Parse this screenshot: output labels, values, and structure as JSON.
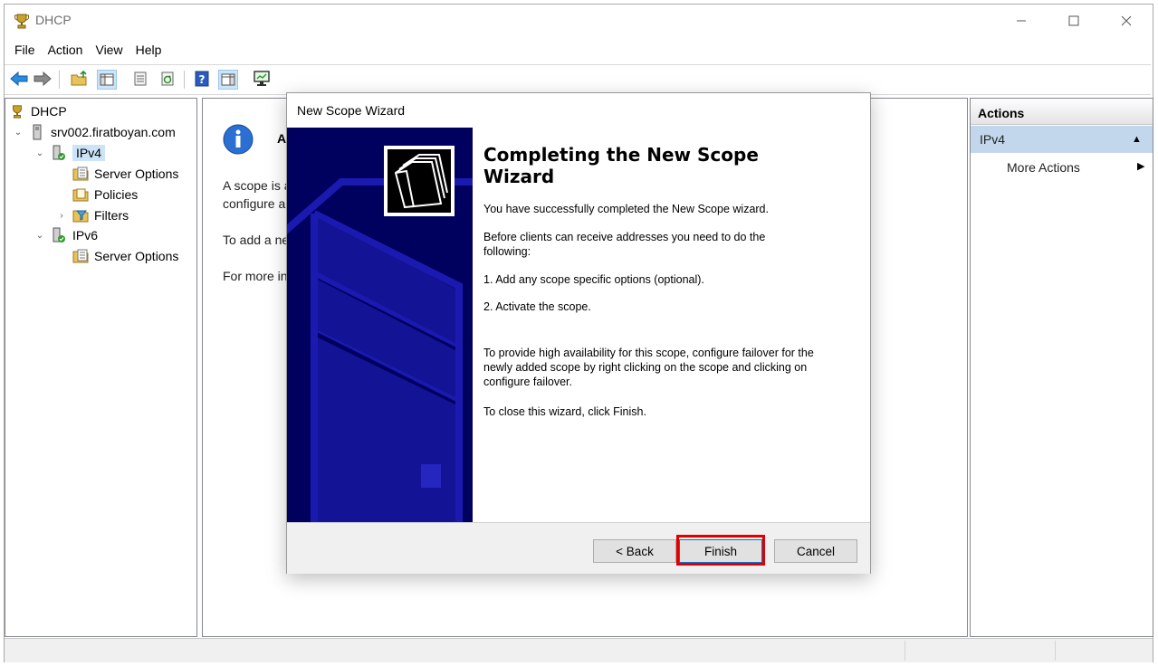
{
  "window": {
    "title": "DHCP",
    "icons": {
      "app": "dhcp-trophy-icon",
      "minimize": "minimize-icon",
      "maximize": "maximize-icon",
      "close": "close-icon"
    }
  },
  "menu": [
    "File",
    "Action",
    "View",
    "Help"
  ],
  "toolbar": {
    "buttons": [
      "back-arrow-icon",
      "forward-arrow-icon",
      "up-folder-icon",
      "show-hide-tree-icon",
      "properties-icon",
      "refresh-icon",
      "help-icon",
      "show-hide-action-pane-icon",
      "monitor-icon"
    ]
  },
  "tree": {
    "root": "DHCP",
    "server": "srv002.firatboyan.com",
    "ipv4": "IPv4",
    "ipv4_children": [
      "Server Options",
      "Policies",
      "Filters"
    ],
    "ipv6": "IPv6",
    "ipv6_children": [
      "Server Options"
    ]
  },
  "center": {
    "heading": "A",
    "lines": [
      "A scope is a",
      "configure a",
      "To add a ne",
      "For more in"
    ]
  },
  "actions": {
    "title": "Actions",
    "group": "IPv4",
    "items": [
      "More Actions"
    ]
  },
  "wizard": {
    "title": "New Scope Wizard",
    "heading": "Completing the New Scope Wizard",
    "paragraphs": [
      "You have successfully completed the New Scope wizard.",
      "Before clients can receive addresses you need to do the following:",
      "1. Add any scope specific options (optional).",
      "2. Activate the scope.",
      "To provide high availability for this scope, configure failover for the newly added scope by right clicking on the scope and clicking on configure failover.",
      "To close this wizard, click Finish."
    ],
    "buttons": {
      "back": "< Back",
      "finish": "Finish",
      "cancel": "Cancel"
    },
    "highlight_color": "#e00000"
  }
}
